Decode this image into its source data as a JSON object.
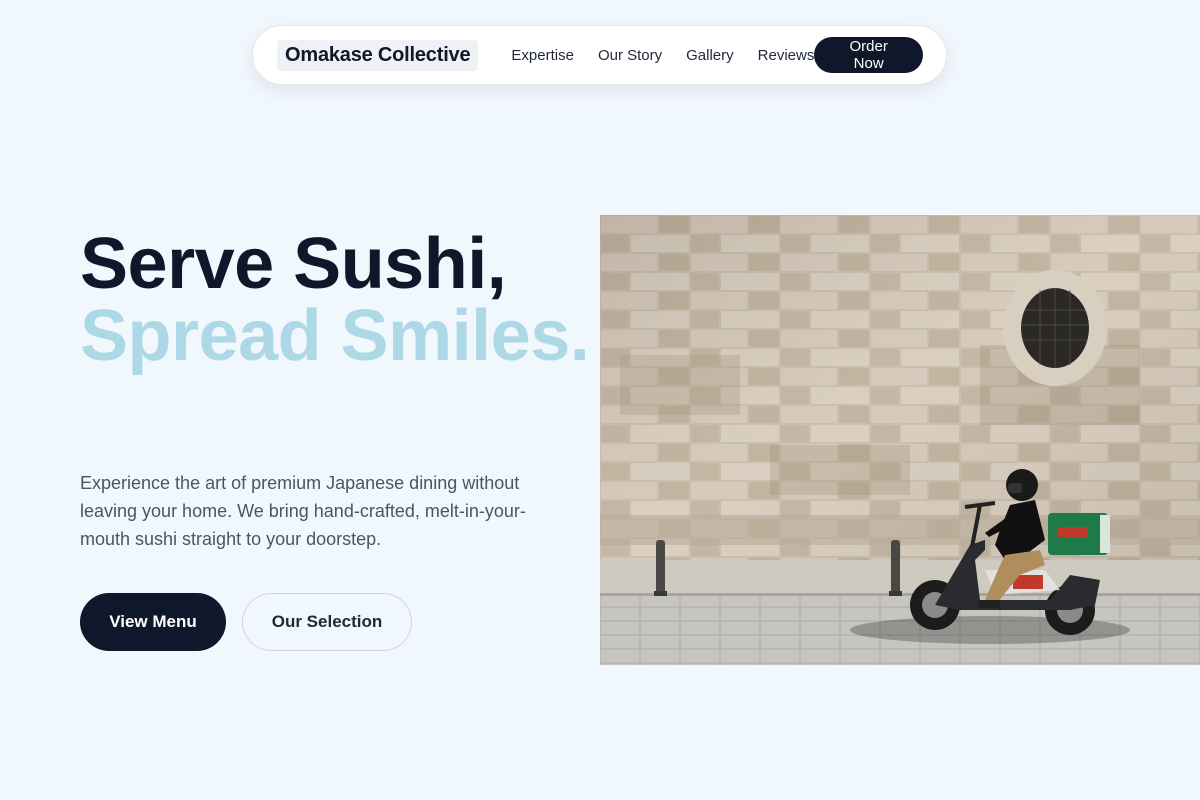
{
  "brand": {
    "name": "Omakase Collective"
  },
  "nav": {
    "links": [
      {
        "label": "Expertise"
      },
      {
        "label": "Our Story"
      },
      {
        "label": "Gallery"
      },
      {
        "label": "Reviews"
      }
    ],
    "cta_label": "Order Now"
  },
  "hero": {
    "headline_line1": "Serve Sushi,",
    "headline_line2": "Spread Smiles.",
    "description": "Experience the art of premium Japanese dining without leaving your home. We bring hand-crafted, melt-in-your-mouth sushi straight to your doorstep.",
    "primary_button": "View Menu",
    "secondary_button": "Our Selection",
    "image": {
      "subject": "delivery rider on scooter in front of stone wall"
    }
  },
  "colors": {
    "background": "#f0f7fd",
    "dark": "#0f172a",
    "accent": "#add8e6",
    "muted_text": "#4b5563"
  }
}
